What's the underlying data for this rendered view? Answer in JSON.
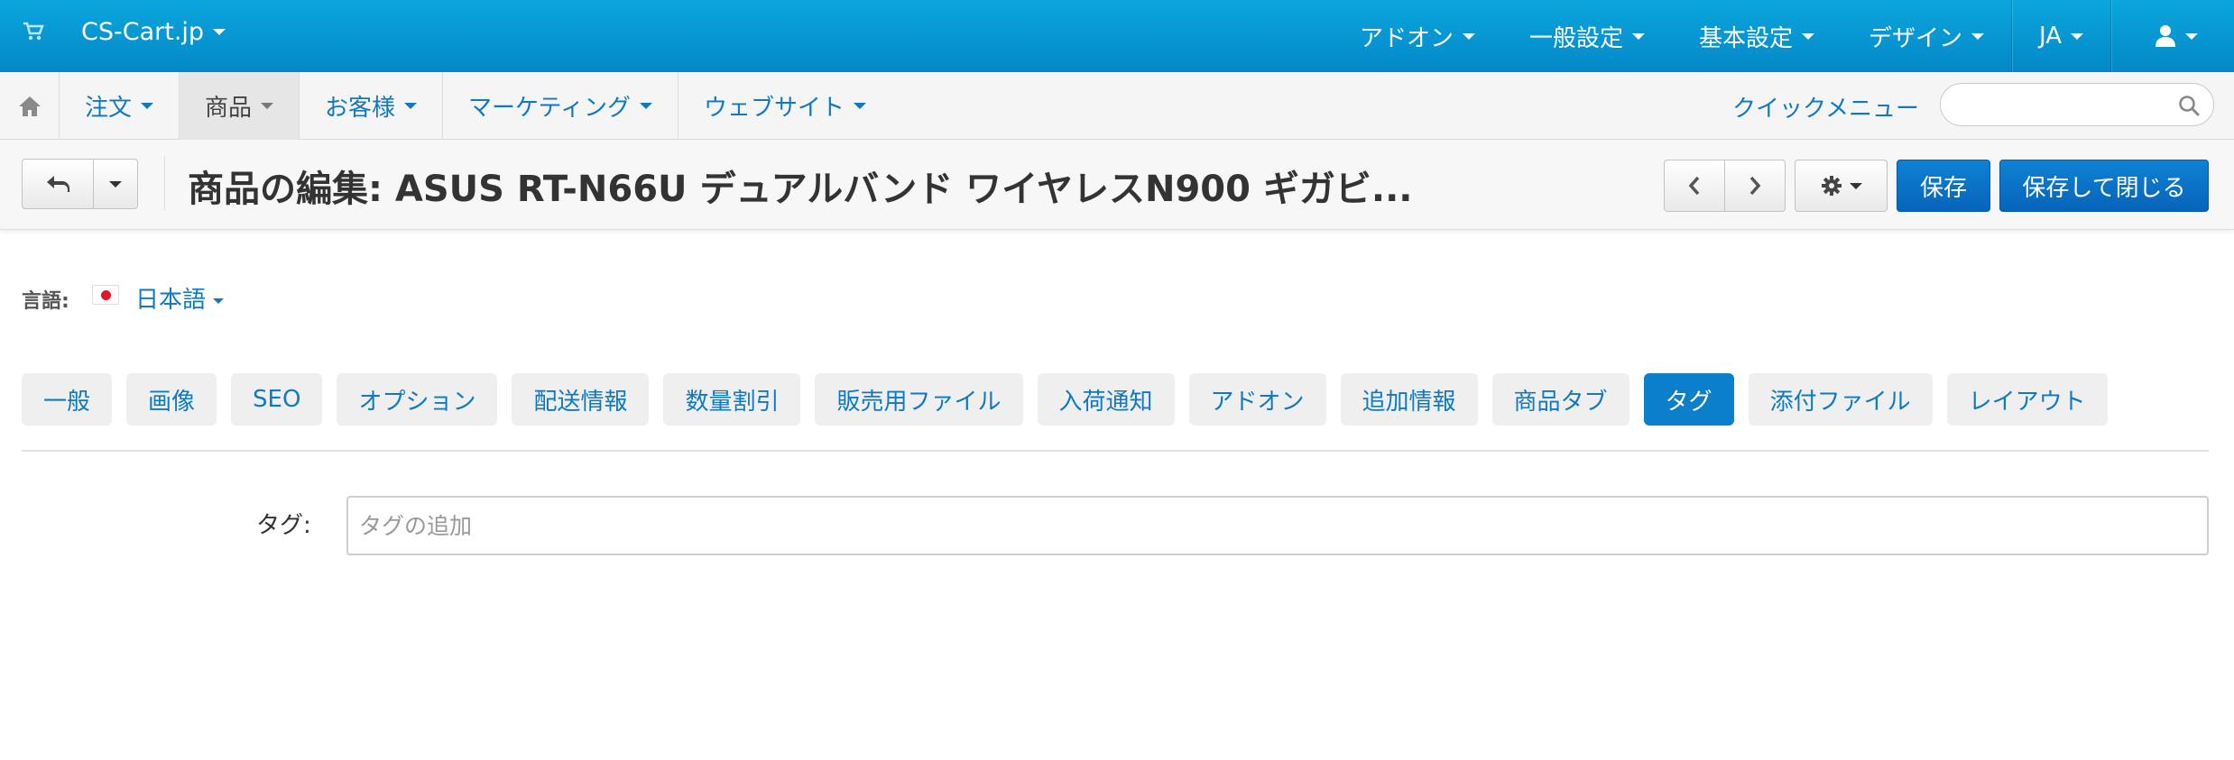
{
  "topbar": {
    "brand": "CS-Cart.jp",
    "menu": [
      {
        "label": "アドオン"
      },
      {
        "label": "一般設定"
      },
      {
        "label": "基本設定"
      },
      {
        "label": "デザイン"
      }
    ],
    "language": "JA"
  },
  "subnav": {
    "items": [
      {
        "label": "注文",
        "active": false
      },
      {
        "label": "商品",
        "active": true
      },
      {
        "label": "お客様",
        "active": false
      },
      {
        "label": "マーケティング",
        "active": false
      },
      {
        "label": "ウェブサイト",
        "active": false
      }
    ],
    "quick_menu": "クイックメニュー",
    "search_placeholder": ""
  },
  "titlebar": {
    "title": "商品の編集: ASUS RT-N66U デュアルバンド ワイヤレスN900 ギガビ...",
    "save": "保存",
    "save_close": "保存して閉じる"
  },
  "language_selector": {
    "label": "言語:",
    "value": "日本語"
  },
  "tabs": [
    {
      "label": "一般",
      "active": false
    },
    {
      "label": "画像",
      "active": false
    },
    {
      "label": "SEO",
      "active": false
    },
    {
      "label": "オプション",
      "active": false
    },
    {
      "label": "配送情報",
      "active": false
    },
    {
      "label": "数量割引",
      "active": false
    },
    {
      "label": "販売用ファイル",
      "active": false
    },
    {
      "label": "入荷通知",
      "active": false
    },
    {
      "label": "アドオン",
      "active": false
    },
    {
      "label": "追加情報",
      "active": false
    },
    {
      "label": "商品タブ",
      "active": false
    },
    {
      "label": "タグ",
      "active": true
    },
    {
      "label": "添付ファイル",
      "active": false
    },
    {
      "label": "レイアウト",
      "active": false
    }
  ],
  "form": {
    "tags_label": "タグ:",
    "tags_placeholder": "タグの追加",
    "tags_value": ""
  },
  "colors": {
    "topbar": "#0aa6dd",
    "link": "#0f7ac2",
    "primary": "#0b7fc9",
    "flag_red": "#e2132a"
  }
}
